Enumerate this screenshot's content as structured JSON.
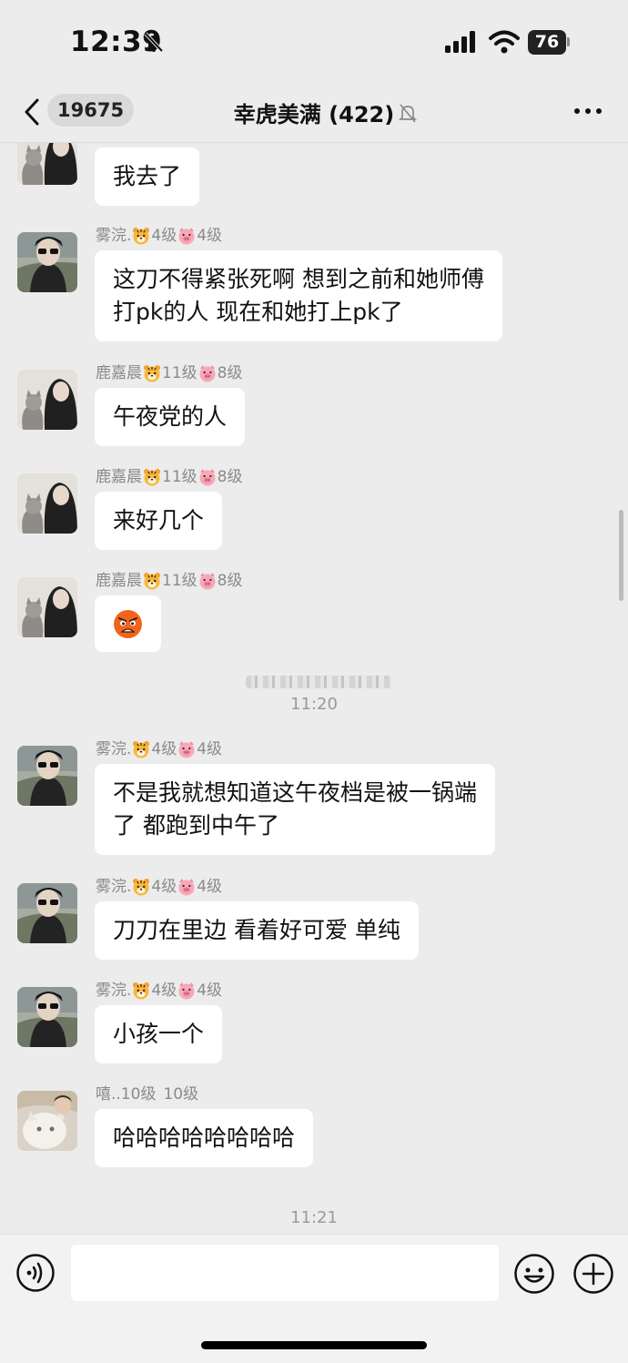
{
  "status_bar": {
    "time": "12:39",
    "battery": "76"
  },
  "nav": {
    "back_count": "19675",
    "title": "幸虎美满 (422)"
  },
  "messages": [
    {
      "sender": "",
      "lines": [
        "我去了"
      ]
    },
    {
      "sender": {
        "name": "雾浣.",
        "lv1": "4级",
        "lv2": "4级"
      },
      "lines": [
        "这刀不得紧张死啊 想到之前和她师傅",
        "打pk的人 现在和她打上pk了"
      ]
    },
    {
      "sender": {
        "name": "鹿嘉晨",
        "lv1": "11级",
        "lv2": "8级"
      },
      "lines": [
        "午夜党的人"
      ]
    },
    {
      "sender": {
        "name": "鹿嘉晨",
        "lv1": "11级",
        "lv2": "8级"
      },
      "lines": [
        "来好几个"
      ]
    },
    {
      "sender": {
        "name": "鹿嘉晨",
        "lv1": "11级",
        "lv2": "8级"
      },
      "sticker": "angry-face-emoji"
    },
    {
      "sender": {
        "name": "雾浣.",
        "lv1": "4级",
        "lv2": "4级"
      },
      "lines": [
        "不是我就想知道这午夜档是被一锅端",
        "了 都跑到中午了"
      ]
    },
    {
      "sender": {
        "name": "雾浣.",
        "lv1": "4级",
        "lv2": "4级"
      },
      "lines": [
        "刀刀在里边 看着好可爱 单纯"
      ]
    },
    {
      "sender": {
        "name": "雾浣.",
        "lv1": "4级",
        "lv2": "4级"
      },
      "lines": [
        "小孩一个"
      ]
    },
    {
      "sender": {
        "name": "嘻..10级",
        "lv2": "10级"
      },
      "lines": [
        "哈哈哈哈哈哈哈哈"
      ]
    }
  ],
  "timestamps": [
    "11:20",
    "11:21"
  ],
  "input": {
    "placeholder": ""
  },
  "colors": {
    "background": "#ececec",
    "bubble": "#ffffff",
    "meta_text": "#8a8a8a"
  },
  "icons": [
    "back-chevron-icon",
    "bell-slash-icon",
    "more-dots-icon",
    "voice-icon",
    "emoji-icon",
    "plus-icon",
    "tiger-emoji-icon",
    "pig-emoji-icon"
  ]
}
